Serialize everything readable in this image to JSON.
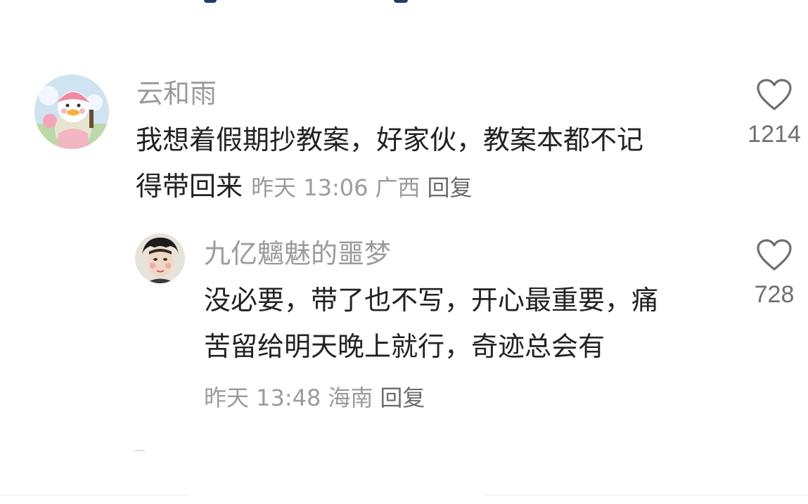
{
  "comment": {
    "username": "云和雨",
    "text_line1": "我想着假期抄教案，好家伙，教案本都不记",
    "text_line2": "得带回来",
    "time": "昨天 13:06",
    "location": "广西",
    "reply_label": "回复",
    "likes": "1214"
  },
  "reply": {
    "username": "九亿魑魅的噩梦",
    "text_line1": "没必要，带了也不写，开心最重要，痛",
    "text_line2": "苦留给明天晚上就行，奇迹总会有",
    "time": "昨天 13:48",
    "location": "海南",
    "reply_label": "回复",
    "likes": "728"
  },
  "icons": {
    "like": "heart-outline-icon"
  },
  "colors": {
    "username": "#9b9b9b",
    "content": "#222222",
    "meta": "#9b9b9b",
    "icon": "#6f6f6f"
  }
}
